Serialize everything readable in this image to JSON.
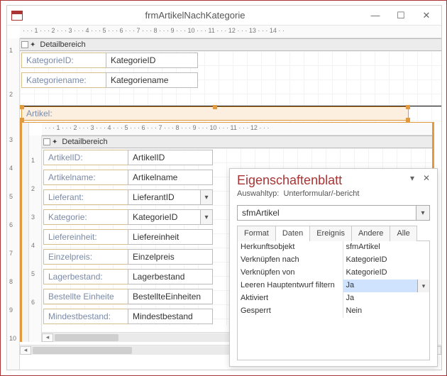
{
  "window": {
    "title": "frmArtikelNachKategorie"
  },
  "main": {
    "section": "Detailbereich",
    "fields": [
      {
        "label": "KategorieID:",
        "value": "KategorieID"
      },
      {
        "label": "Kategoriename:",
        "value": "Kategoriename"
      }
    ],
    "artikel_label": "Artikel:"
  },
  "sub": {
    "section": "Detailbereich",
    "fields": [
      {
        "label": "ArtikelID:",
        "value": "ArtikelID",
        "combo": false
      },
      {
        "label": "Artikelname:",
        "value": "Artikelname",
        "combo": false
      },
      {
        "label": "Lieferant:",
        "value": "LieferantID",
        "combo": true
      },
      {
        "label": "Kategorie:",
        "value": "KategorieID",
        "combo": true
      },
      {
        "label": "Liefereinheit:",
        "value": "Liefereinheit",
        "combo": false
      },
      {
        "label": "Einzelpreis:",
        "value": "Einzelpreis",
        "combo": false
      },
      {
        "label": "Lagerbestand:",
        "value": "Lagerbestand",
        "combo": false
      },
      {
        "label": "Bestellte Einheite",
        "value": "BestellteEinheiten",
        "combo": false
      },
      {
        "label": "Mindestbestand:",
        "value": "Mindestbestand",
        "combo": false
      }
    ]
  },
  "ruler": {
    "main_h": "· · · 1 · · · 2 · · · 3 · · · 4 · · · 5 · · · 6 · · · 7 · · · 8 · · · 9 · · · 10 · · · 11 · · · 12 · · · 13 · · · 14 · ·",
    "sub_h": "· · · 1 · · · 2 · · · 3 · · · 4 · · · 5 · · · 6 · · · 7 · · · 8 · · · 9 · · · 10 · · · 11 · · · 12 · · ·",
    "main_v": [
      "1",
      "2"
    ],
    "sub_v": [
      "1",
      "2",
      "3",
      "4",
      "5",
      "6"
    ],
    "outer_v": [
      "3",
      "4",
      "5",
      "6",
      "7",
      "8",
      "9",
      "10"
    ]
  },
  "props": {
    "title": "Eigenschaftenblatt",
    "subtype_label": "Auswahltyp:",
    "subtype_value": "Unterformular/-bericht",
    "selected_object": "sfmArtikel",
    "tabs": [
      "Format",
      "Daten",
      "Ereignis",
      "Andere",
      "Alle"
    ],
    "active_tab": "Daten",
    "rows": [
      {
        "k": "Herkunftsobjekt",
        "v": "sfmArtikel"
      },
      {
        "k": "Verknüpfen nach",
        "v": "KategorieID"
      },
      {
        "k": "Verknüpfen von",
        "v": "KategorieID"
      },
      {
        "k": "Leeren Hauptentwurf filtern",
        "v": "Ja",
        "selected": true
      },
      {
        "k": "Aktiviert",
        "v": "Ja"
      },
      {
        "k": "Gesperrt",
        "v": "Nein"
      }
    ]
  }
}
